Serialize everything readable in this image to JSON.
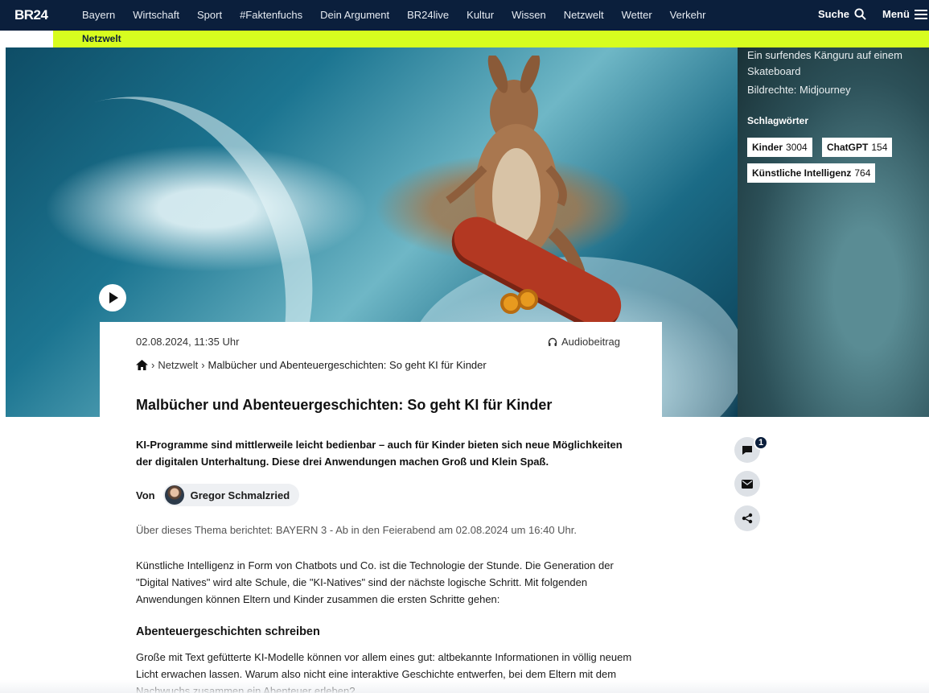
{
  "header": {
    "logo": "BR24",
    "nav": [
      "Bayern",
      "Wirtschaft",
      "Sport",
      "#Faktenfuchs",
      "Dein Argument",
      "BR24live",
      "Kultur",
      "Wissen",
      "Netzwelt",
      "Wetter",
      "Verkehr"
    ],
    "search_label": "Suche",
    "menu_label": "Menü",
    "section": "Netzwelt"
  },
  "media": {
    "caption": "Ein surfendes Känguru auf einem Skateboard",
    "credit": "Bildrechte: Midjourney",
    "tags_title": "Schlagwörter",
    "tags": [
      {
        "name": "Kinder",
        "count": "3004"
      },
      {
        "name": "ChatGPT",
        "count": "154"
      },
      {
        "name": "Künstliche Intelligenz",
        "count": "764"
      }
    ]
  },
  "article": {
    "date": "02.08.2024, 11:35 Uhr",
    "audio_label": "Audiobeitrag",
    "breadcrumb": {
      "section": "Netzwelt",
      "current": "Malbücher und Abenteuergeschichten: So geht KI für Kinder"
    },
    "title": "Malbücher und Abenteuergeschichten: So geht KI für Kinder",
    "lead": "KI-Programme sind mittlerweile leicht bedienbar – auch für Kinder bieten sich neue Möglichkeiten der digitalen Unterhaltung. Diese drei Anwendungen machen Groß und Klein Spaß.",
    "author_prefix": "Von",
    "author": "Gregor Schmalzried",
    "topic_note": "Über dieses Thema berichtet: BAYERN 3 - Ab in den Feierabend am 02.08.2024 um 16:40 Uhr.",
    "paragraph1": "Künstliche Intelligenz in Form von Chatbots und Co. ist die Technologie der Stunde. Die Generation der \"Digital Natives\" wird alte Schule, die \"KI-Natives\" sind der nächste logische Schritt. Mit folgenden Anwendungen können Eltern und Kinder zusammen die ersten Schritte gehen:",
    "subheading": "Abenteuergeschichten schreiben",
    "paragraph2": "Große mit Text gefütterte KI-Modelle können vor allem eines gut: altbekannte Informationen in völlig neuem Licht erwachen lassen. Warum also nicht eine interaktive Geschichte entwerfen, bei dem Eltern mit dem Nachwuchs zusammen ein Abenteuer erleben?"
  },
  "share": {
    "comment_count": "1",
    "icons": [
      "comment-icon",
      "mail-icon",
      "share-icon"
    ]
  },
  "colors": {
    "nav_bg": "#0b1f3c",
    "accent": "#d7fd1f"
  }
}
